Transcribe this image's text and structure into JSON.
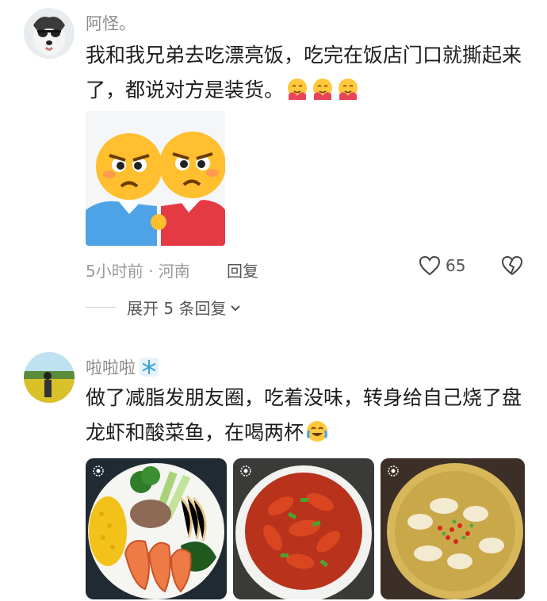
{
  "comments": [
    {
      "username": "阿怪。",
      "text": "我和我兄弟去吃漂亮饭，吃完在饭店门口就撕起来了，都说对方是装货。",
      "time_location": "5小时前 · 河南",
      "reply_label": "回复",
      "likes": "65",
      "expand_label": "展开 5 条回复"
    },
    {
      "username": "啦啦啦",
      "text": "做了减脂发朋友圈，吃着没味，转身给自己烧了盘龙虾和酸菜鱼，在喝两杯"
    }
  ],
  "icons": [
    "avatar-dog-icon",
    "hug-emoji-icon",
    "angry-face-sticker",
    "heart-outline-icon",
    "broken-heart-icon",
    "chevron-down-icon",
    "snowflake-icon",
    "cry-laugh-emoji-icon",
    "live-photo-icon"
  ],
  "colors": {
    "text": "#1c1c1c",
    "meta": "#9a9a9a",
    "username": "#8a8a8a"
  }
}
